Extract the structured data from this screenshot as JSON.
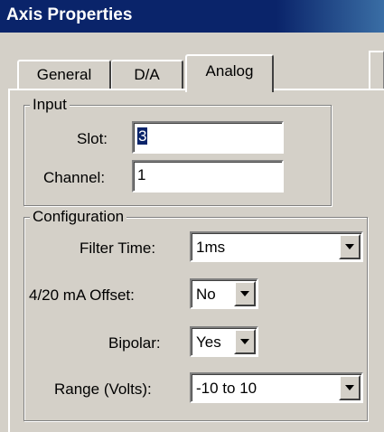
{
  "window": {
    "title": "Axis Properties"
  },
  "tabs": [
    {
      "label": "General"
    },
    {
      "label": "D/A"
    },
    {
      "label": "Analog",
      "selected": true
    }
  ],
  "input_group": {
    "legend": "Input",
    "slot": {
      "label": "Slot:",
      "value": "3"
    },
    "channel": {
      "label": "Channel:",
      "value": "1"
    }
  },
  "configuration_group": {
    "legend": "Configuration",
    "filter_time": {
      "label": "Filter Time:",
      "value": "1ms"
    },
    "offset": {
      "label": "4/20 mA Offset:",
      "value": "No"
    },
    "bipolar": {
      "label": "Bipolar:",
      "value": "Yes"
    },
    "range": {
      "label": "Range (Volts):",
      "value": "-10 to 10"
    }
  },
  "icons": {
    "dropdown": "chevron-down-icon"
  }
}
